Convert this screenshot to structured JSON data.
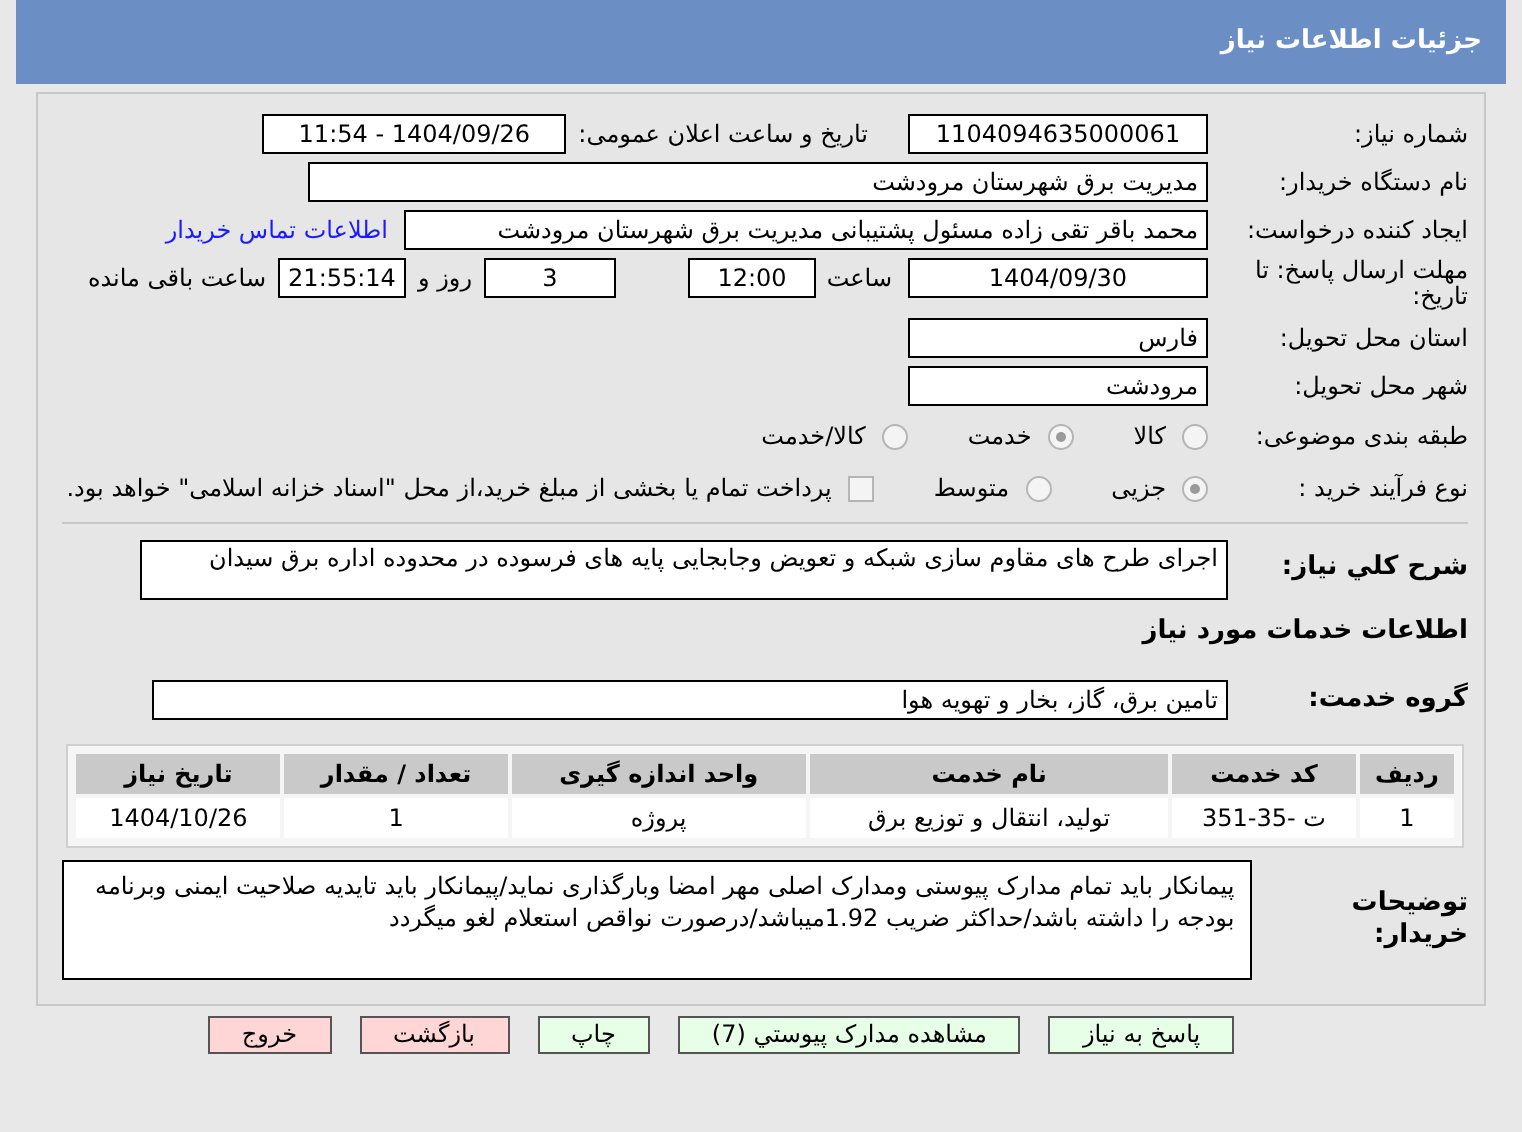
{
  "header": {
    "title": "جزئیات اطلاعات نیاز"
  },
  "need_number": {
    "label": "شماره نیاز:",
    "value": "1104094635000061"
  },
  "announce": {
    "label": "تاریخ و ساعت اعلان عمومی:",
    "value": "1404/09/26 - 11:54"
  },
  "buyer": {
    "label": "نام دستگاه خریدار:",
    "value": "مدیریت برق شهرستان مرودشت"
  },
  "creator": {
    "label": "ایجاد کننده درخواست:",
    "value": "محمد باقر  تقی زاده مسئول پشتیبانی مدیریت برق شهرستان مرودشت",
    "link": "اطلاعات تماس خریدار"
  },
  "deadline": {
    "label": "مهلت ارسال پاسخ: تا تاریخ:",
    "date": "1404/09/30",
    "time_label": "ساعت",
    "time": "12:00",
    "days": "3",
    "days_label": "روز و",
    "remaining": "21:55:14",
    "remaining_label": "ساعت باقی مانده"
  },
  "province": {
    "label": "استان محل تحویل:",
    "value": "فارس"
  },
  "city": {
    "label": "شهر محل تحویل:",
    "value": "مرودشت"
  },
  "category": {
    "label": "طبقه بندی موضوعی:",
    "options": [
      {
        "label": "کالا",
        "selected": false
      },
      {
        "label": "خدمت",
        "selected": true
      },
      {
        "label": "کالا/خدمت",
        "selected": false
      }
    ]
  },
  "process": {
    "label": "نوع فرآیند خرید :",
    "options": [
      {
        "label": "جزیی",
        "selected": true
      },
      {
        "label": "متوسط",
        "selected": false
      }
    ],
    "payment": {
      "label": "پرداخت تمام یا بخشی از مبلغ خرید،از محل \"اسناد خزانه اسلامی\" خواهد بود.",
      "checked": false
    }
  },
  "description": {
    "label": "شرح کلي نیاز:",
    "value": "اجرای طرح های مقاوم سازی شبکه و تعویض وجابجایی پایه های فرسوده در محدوده اداره برق سیدان"
  },
  "services_heading": "اطلاعات خدمات مورد نیاز",
  "service_group": {
    "label": "گروه خدمت:",
    "value": "تامین برق، گاز، بخار و تهویه هوا"
  },
  "table": {
    "columns": [
      "ردیف",
      "کد خدمت",
      "نام خدمت",
      "واحد اندازه گیری",
      "تعداد / مقدار",
      "تاریخ نیاز"
    ],
    "rows": [
      [
        "1",
        "ت -35-351",
        "تولید، انتقال و توزیع برق",
        "پروژه",
        "1",
        "1404/10/26"
      ]
    ]
  },
  "notes": {
    "label": "توضیحات خریدار:",
    "value": "پیمانکار باید تمام مدارک پیوستی ومدارک اصلی مهر امضا وبارگذاری نماید/پیمانکار باید تایدیه صلاحیت ایمنی وبرنامه بودجه را داشته باشد/حداکثر ضریب 1.92میباشد/درصورت نواقص استعلام لغو میگردد"
  },
  "buttons": [
    {
      "label": "پاسخ به نیاز",
      "kind": "green"
    },
    {
      "label": "مشاهده مدارک پیوستي (7)",
      "kind": "green"
    },
    {
      "label": "چاپ",
      "kind": "green"
    },
    {
      "label": "بازگشت",
      "kind": "red"
    },
    {
      "label": "خروج",
      "kind": "red"
    }
  ]
}
